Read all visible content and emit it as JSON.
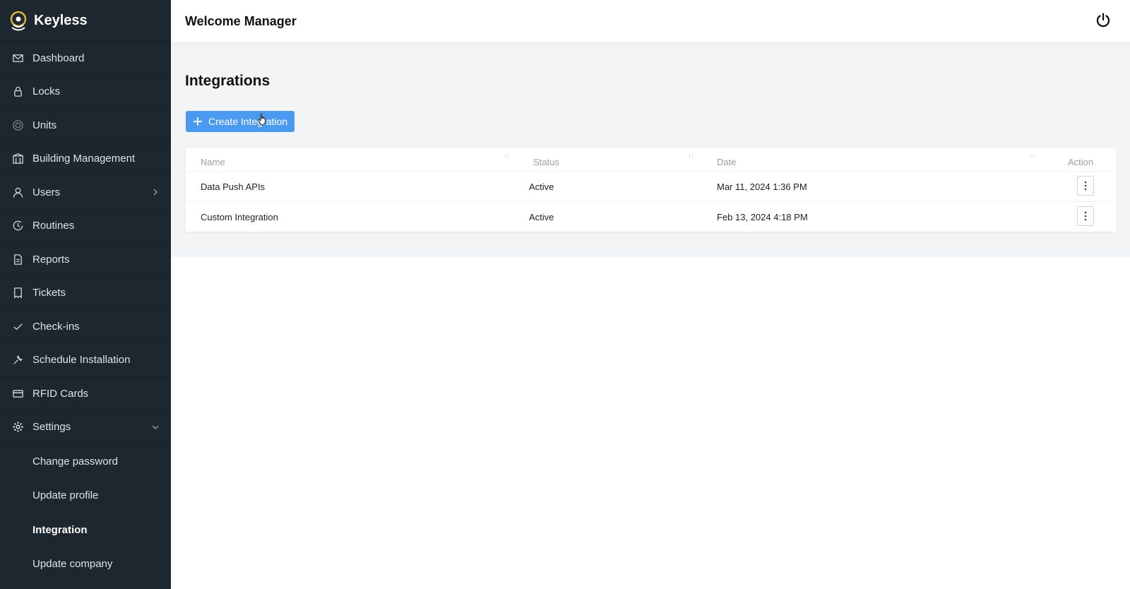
{
  "app": {
    "name": "Keyless"
  },
  "header": {
    "title": "Welcome Manager",
    "power_icon": "power-icon"
  },
  "sidebar": {
    "items": [
      {
        "label": "Dashboard",
        "icon": "mail-icon"
      },
      {
        "label": "Locks",
        "icon": "lock-icon"
      },
      {
        "label": "Units",
        "icon": "units-icon"
      },
      {
        "label": "Building Management",
        "icon": "building-icon"
      },
      {
        "label": "Users",
        "icon": "user-icon",
        "expand": "chevron-right-icon"
      },
      {
        "label": "Routines",
        "icon": "clock-icon"
      },
      {
        "label": "Reports",
        "icon": "file-icon"
      },
      {
        "label": "Tickets",
        "icon": "ticket-icon"
      },
      {
        "label": "Check-ins",
        "icon": "check-icon"
      },
      {
        "label": "Schedule Installation",
        "icon": "tool-icon"
      },
      {
        "label": "RFID Cards",
        "icon": "card-icon"
      },
      {
        "label": "Settings",
        "icon": "gear-icon",
        "expand": "chevron-down-icon"
      }
    ],
    "settings_sub": [
      {
        "label": "Change password"
      },
      {
        "label": "Update profile"
      },
      {
        "label": "Integration",
        "active": true
      },
      {
        "label": "Update company"
      }
    ]
  },
  "main": {
    "title": "Integrations",
    "create_button": "Create Integration",
    "table": {
      "columns": [
        "Name",
        "Status",
        "Date",
        "Action"
      ],
      "rows": [
        {
          "name": "Data Push APIs",
          "status": "Active",
          "date": "Mar 11, 2024 1:36 PM"
        },
        {
          "name": "Custom Integration",
          "status": "Active",
          "date": "Feb 13, 2024 4:18 PM"
        }
      ]
    }
  },
  "colors": {
    "sidebar_bg": "#1c2730",
    "accent": "#4a9af0",
    "page_bg": "#f3f4f6"
  }
}
